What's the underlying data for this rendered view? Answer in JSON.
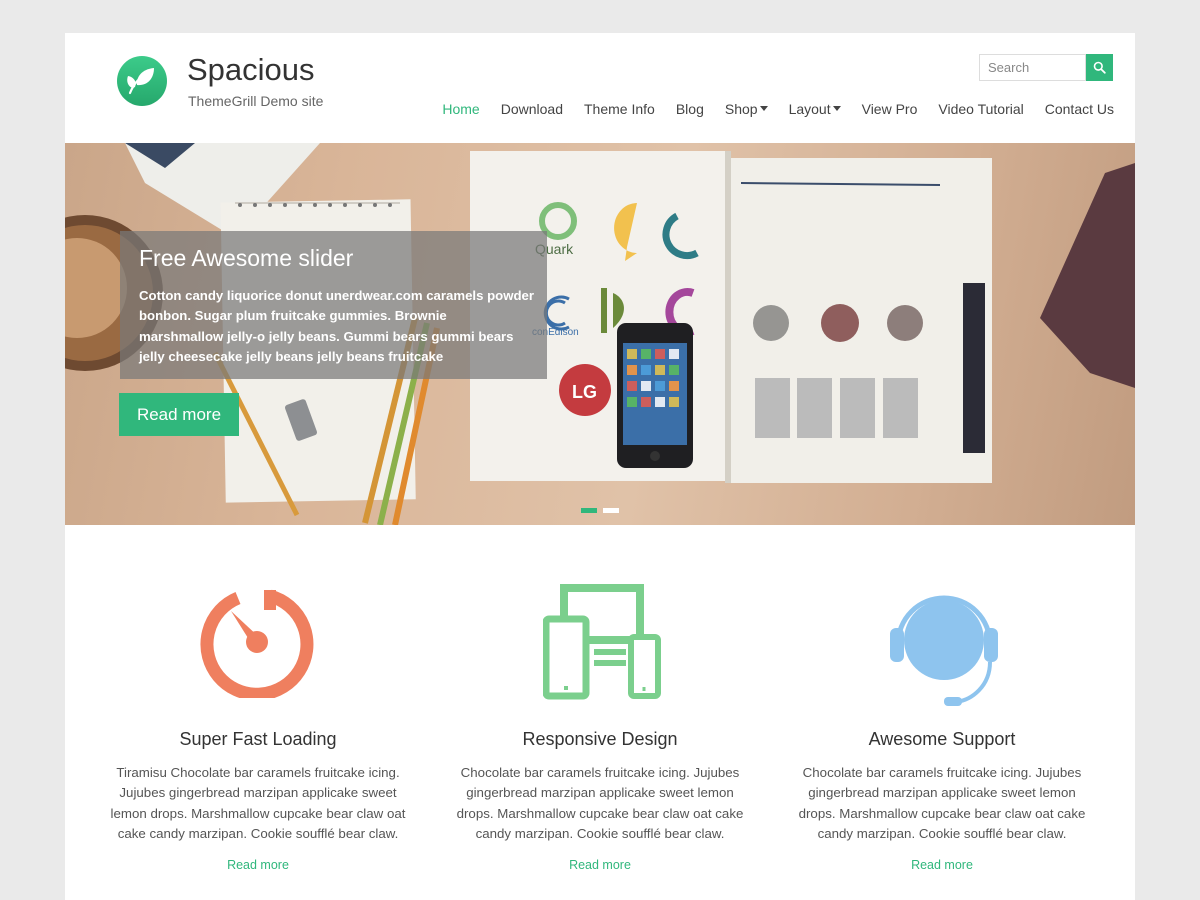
{
  "colors": {
    "accent": "#30b77c",
    "background": "#eaeaea",
    "speed_icon": "#ef7f5f",
    "responsive_icon": "#7bcf8d",
    "support_icon": "#8ec4ee"
  },
  "header": {
    "site_title": "Spacious",
    "site_description": "ThemeGrill Demo site",
    "logo_icon": "leaf-logo-icon",
    "search": {
      "placeholder": "Search",
      "icon": "search-icon"
    }
  },
  "nav": {
    "items": [
      {
        "label": "Home",
        "active": true
      },
      {
        "label": "Download"
      },
      {
        "label": "Theme Info"
      },
      {
        "label": "Blog"
      },
      {
        "label": "Shop",
        "dropdown": true
      },
      {
        "label": "Layout",
        "dropdown": true
      },
      {
        "label": "View Pro"
      },
      {
        "label": "Video Tutorial"
      },
      {
        "label": "Contact Us"
      }
    ]
  },
  "slider": {
    "title": "Free Awesome slider",
    "text": "Cotton candy liquorice donut unerdwear.com caramels powder bonbon. Sugar plum fruitcake gummies. Brownie marshmallow jelly-o jelly beans. Gummi bears gummi bears jelly cheesecake jelly beans jelly beans fruitcake",
    "button": "Read more",
    "slide_count": 2,
    "active_slide": 1,
    "image_labels": {
      "quark": "Quark",
      "conedison": "conEdison",
      "lg": "LG"
    }
  },
  "features": [
    {
      "icon": "speedometer-icon",
      "title": "Super Fast Loading",
      "text": "Tiramisu Chocolate bar caramels fruitcake icing. Jujubes gingerbread marzipan applicake sweet lemon drops. Marshmallow cupcake bear claw oat cake candy marzipan. Cookie soufflé bear claw.",
      "link": "Read more"
    },
    {
      "icon": "responsive-devices-icon",
      "title": "Responsive Design",
      "text": "Chocolate bar caramels fruitcake icing. Jujubes gingerbread marzipan applicake sweet lemon drops. Marshmallow cupcake bear claw oat cake candy marzipan. Cookie soufflé bear claw.",
      "link": "Read more"
    },
    {
      "icon": "headset-support-icon",
      "title": "Awesome Support",
      "text": "Chocolate bar caramels fruitcake icing. Jujubes gingerbread marzipan applicake sweet lemon drops. Marshmallow cupcake bear claw oat cake candy marzipan. Cookie soufflé bear claw.",
      "link": "Read more"
    }
  ]
}
